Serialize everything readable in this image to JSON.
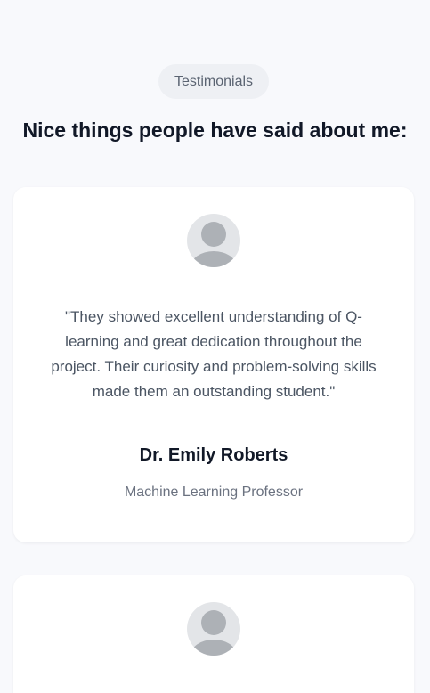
{
  "section": {
    "badge": "Testimonials",
    "heading": "Nice things people have said about me:"
  },
  "testimonials": [
    {
      "quote": "\"They showed excellent understanding of Q-learning and great dedication throughout the project. Their curiosity and problem-solving skills made them an outstanding student.\"",
      "name": "Dr. Emily Roberts",
      "role": "Machine Learning Professor",
      "avatar_icon": "user-avatar-icon"
    },
    {
      "avatar_icon": "user-avatar-icon"
    }
  ],
  "colors": {
    "background": "#f8f9fc",
    "card": "#ffffff",
    "badge_bg": "#eef0f4",
    "avatar_bg": "#e3e5e8",
    "avatar_fg": "#adb1b6"
  }
}
